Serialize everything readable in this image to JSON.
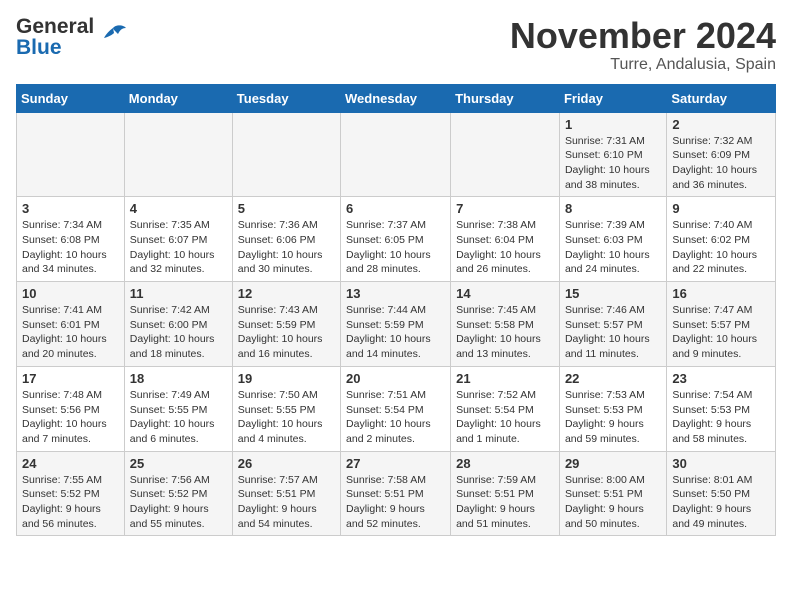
{
  "header": {
    "logo_general": "General",
    "logo_blue": "Blue",
    "month_title": "November 2024",
    "location": "Turre, Andalusia, Spain"
  },
  "weekdays": [
    "Sunday",
    "Monday",
    "Tuesday",
    "Wednesday",
    "Thursday",
    "Friday",
    "Saturday"
  ],
  "weeks": [
    [
      {
        "day": "",
        "content": ""
      },
      {
        "day": "",
        "content": ""
      },
      {
        "day": "",
        "content": ""
      },
      {
        "day": "",
        "content": ""
      },
      {
        "day": "",
        "content": ""
      },
      {
        "day": "1",
        "content": "Sunrise: 7:31 AM\nSunset: 6:10 PM\nDaylight: 10 hours and 38 minutes."
      },
      {
        "day": "2",
        "content": "Sunrise: 7:32 AM\nSunset: 6:09 PM\nDaylight: 10 hours and 36 minutes."
      }
    ],
    [
      {
        "day": "3",
        "content": "Sunrise: 7:34 AM\nSunset: 6:08 PM\nDaylight: 10 hours and 34 minutes."
      },
      {
        "day": "4",
        "content": "Sunrise: 7:35 AM\nSunset: 6:07 PM\nDaylight: 10 hours and 32 minutes."
      },
      {
        "day": "5",
        "content": "Sunrise: 7:36 AM\nSunset: 6:06 PM\nDaylight: 10 hours and 30 minutes."
      },
      {
        "day": "6",
        "content": "Sunrise: 7:37 AM\nSunset: 6:05 PM\nDaylight: 10 hours and 28 minutes."
      },
      {
        "day": "7",
        "content": "Sunrise: 7:38 AM\nSunset: 6:04 PM\nDaylight: 10 hours and 26 minutes."
      },
      {
        "day": "8",
        "content": "Sunrise: 7:39 AM\nSunset: 6:03 PM\nDaylight: 10 hours and 24 minutes."
      },
      {
        "day": "9",
        "content": "Sunrise: 7:40 AM\nSunset: 6:02 PM\nDaylight: 10 hours and 22 minutes."
      }
    ],
    [
      {
        "day": "10",
        "content": "Sunrise: 7:41 AM\nSunset: 6:01 PM\nDaylight: 10 hours and 20 minutes."
      },
      {
        "day": "11",
        "content": "Sunrise: 7:42 AM\nSunset: 6:00 PM\nDaylight: 10 hours and 18 minutes."
      },
      {
        "day": "12",
        "content": "Sunrise: 7:43 AM\nSunset: 5:59 PM\nDaylight: 10 hours and 16 minutes."
      },
      {
        "day": "13",
        "content": "Sunrise: 7:44 AM\nSunset: 5:59 PM\nDaylight: 10 hours and 14 minutes."
      },
      {
        "day": "14",
        "content": "Sunrise: 7:45 AM\nSunset: 5:58 PM\nDaylight: 10 hours and 13 minutes."
      },
      {
        "day": "15",
        "content": "Sunrise: 7:46 AM\nSunset: 5:57 PM\nDaylight: 10 hours and 11 minutes."
      },
      {
        "day": "16",
        "content": "Sunrise: 7:47 AM\nSunset: 5:57 PM\nDaylight: 10 hours and 9 minutes."
      }
    ],
    [
      {
        "day": "17",
        "content": "Sunrise: 7:48 AM\nSunset: 5:56 PM\nDaylight: 10 hours and 7 minutes."
      },
      {
        "day": "18",
        "content": "Sunrise: 7:49 AM\nSunset: 5:55 PM\nDaylight: 10 hours and 6 minutes."
      },
      {
        "day": "19",
        "content": "Sunrise: 7:50 AM\nSunset: 5:55 PM\nDaylight: 10 hours and 4 minutes."
      },
      {
        "day": "20",
        "content": "Sunrise: 7:51 AM\nSunset: 5:54 PM\nDaylight: 10 hours and 2 minutes."
      },
      {
        "day": "21",
        "content": "Sunrise: 7:52 AM\nSunset: 5:54 PM\nDaylight: 10 hours and 1 minute."
      },
      {
        "day": "22",
        "content": "Sunrise: 7:53 AM\nSunset: 5:53 PM\nDaylight: 9 hours and 59 minutes."
      },
      {
        "day": "23",
        "content": "Sunrise: 7:54 AM\nSunset: 5:53 PM\nDaylight: 9 hours and 58 minutes."
      }
    ],
    [
      {
        "day": "24",
        "content": "Sunrise: 7:55 AM\nSunset: 5:52 PM\nDaylight: 9 hours and 56 minutes."
      },
      {
        "day": "25",
        "content": "Sunrise: 7:56 AM\nSunset: 5:52 PM\nDaylight: 9 hours and 55 minutes."
      },
      {
        "day": "26",
        "content": "Sunrise: 7:57 AM\nSunset: 5:51 PM\nDaylight: 9 hours and 54 minutes."
      },
      {
        "day": "27",
        "content": "Sunrise: 7:58 AM\nSunset: 5:51 PM\nDaylight: 9 hours and 52 minutes."
      },
      {
        "day": "28",
        "content": "Sunrise: 7:59 AM\nSunset: 5:51 PM\nDaylight: 9 hours and 51 minutes."
      },
      {
        "day": "29",
        "content": "Sunrise: 8:00 AM\nSunset: 5:51 PM\nDaylight: 9 hours and 50 minutes."
      },
      {
        "day": "30",
        "content": "Sunrise: 8:01 AM\nSunset: 5:50 PM\nDaylight: 9 hours and 49 minutes."
      }
    ]
  ]
}
